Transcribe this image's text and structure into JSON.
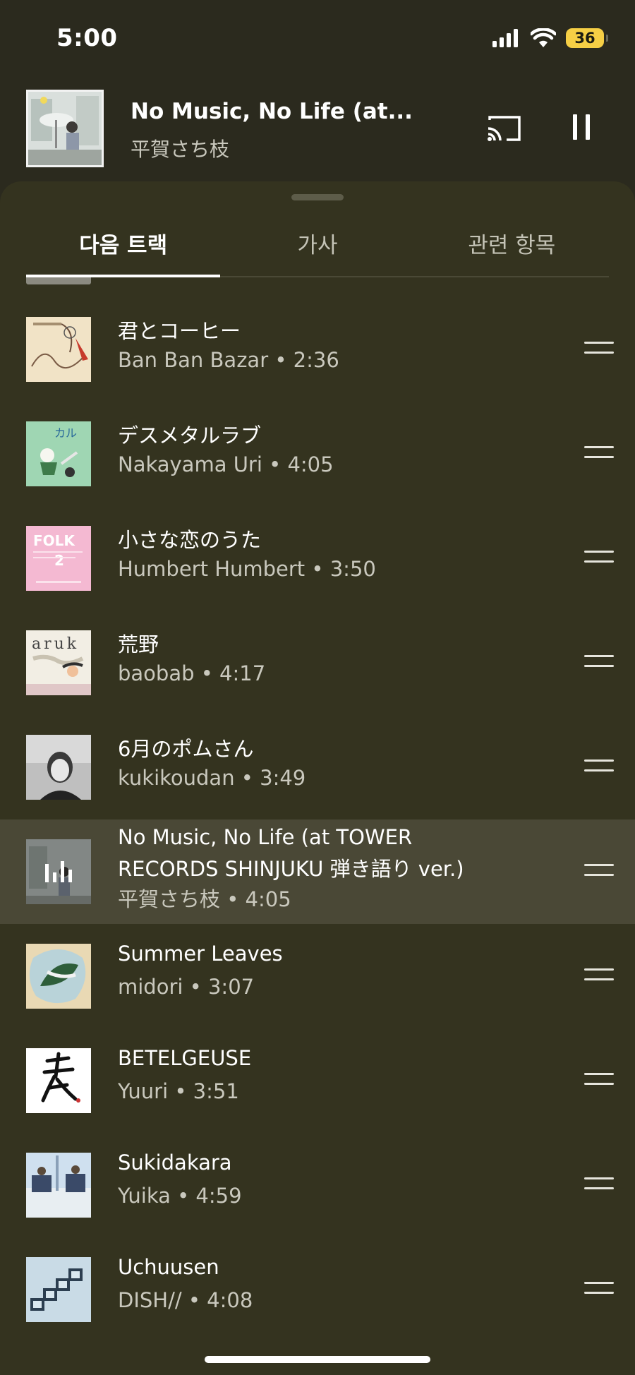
{
  "status": {
    "time": "5:00",
    "battery": "36"
  },
  "now_playing": {
    "title": "No Music, No Life (at...",
    "artist": "平賀さち枝"
  },
  "tabs": [
    {
      "label": "다음 트랙"
    },
    {
      "label": "가사"
    },
    {
      "label": "관련 항목"
    }
  ],
  "queue": [
    {
      "title": "君とコーヒー",
      "sub": "Ban Ban Bazar • 2:36"
    },
    {
      "title": "デスメタルラブ",
      "sub": "Nakayama Uri • 4:05"
    },
    {
      "title": "小さな恋のうた",
      "sub": "Humbert Humbert • 3:50"
    },
    {
      "title": "荒野",
      "sub": "baobab • 4:17"
    },
    {
      "title": "6月のポムさん",
      "sub": "kukikoudan • 3:49"
    },
    {
      "title": "No Music, No Life (at TOWER",
      "title2": "RECORDS SHINJUKU 弾き語り ver.)",
      "sub": "平賀さち枝 • 4:05"
    },
    {
      "title": "Summer Leaves",
      "sub": "midori • 3:07"
    },
    {
      "title": "BETELGEUSE",
      "sub": "Yuuri • 3:51"
    },
    {
      "title": "Sukidakara",
      "sub": "Yuika • 4:59"
    },
    {
      "title": "Uchuusen",
      "sub": "DISH// • 4:08"
    }
  ],
  "album_art": {
    "folk_text": "FOLK",
    "folk_number": "2",
    "aruk_text": "aruk",
    "karu_text": "カル"
  }
}
